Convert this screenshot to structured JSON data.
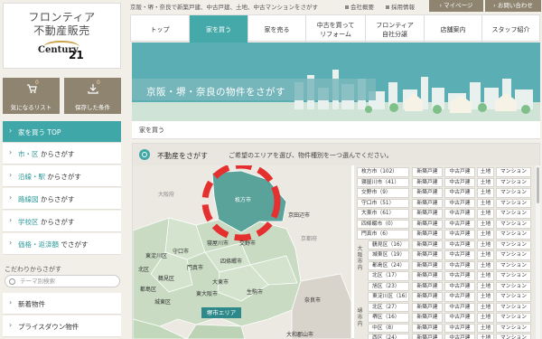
{
  "brand": {
    "line1": "フロンティア",
    "line2": "不動産販売",
    "logo_word": "Century",
    "logo_num": "21"
  },
  "top_util": {
    "tagline": "京阪・堺・奈良で新築戸建、中古戸建、土地、中古マンションをさがす",
    "links": [
      "会社概要",
      "採用情報"
    ],
    "buttons": [
      "マイページ",
      "お問い合わせ"
    ]
  },
  "sidebar": {
    "fav_label": "気になるリスト",
    "fav_count": "0",
    "saved_label": "保存した条件",
    "saved_count": "0",
    "items": [
      {
        "strong": "家を買う TOP",
        "rest": ""
      },
      {
        "strong": "市・区",
        "rest": " からさがす"
      },
      {
        "strong": "沿線・駅",
        "rest": " からさがす"
      },
      {
        "strong": "路線図",
        "rest": " からさがす"
      },
      {
        "strong": "学校区",
        "rest": " からさがす"
      },
      {
        "strong": "価格・返済額",
        "rest": " でさがす"
      }
    ],
    "kodawari_heading": "こだわりからさがす",
    "tag_placeholder": "テーマ別検索",
    "sub_items": [
      "新着物件",
      "プライスダウン物件"
    ]
  },
  "nav": {
    "tabs": [
      {
        "l1": "トップ",
        "l2": ""
      },
      {
        "l1": "家を買う",
        "l2": ""
      },
      {
        "l1": "家を売る",
        "l2": ""
      },
      {
        "l1": "中古を買って",
        "l2": "リフォーム"
      },
      {
        "l1": "フロンティア",
        "l2": "自社分譲"
      },
      {
        "l1": "店舗案内",
        "l2": ""
      },
      {
        "l1": "スタッフ紹介",
        "l2": ""
      }
    ],
    "active_index": 1
  },
  "hero": {
    "title": "京阪・堺・奈良の物件をさがす"
  },
  "breadcrumb": "家を買う",
  "search": {
    "title": "不動産をさがす",
    "instruction": "ご希望のエリアを選び、物件種別を一つ選んでください。",
    "sakai_area": "堺市エリア",
    "map_labels": {
      "kyoto": "京都府",
      "osaka_fu": "大阪府",
      "hirakata": "枚方市",
      "kyotanabe": "京田辺市",
      "katano": "交野市",
      "neyagawa": "寝屋川市",
      "shijonawate": "四條畷市",
      "moriguchi": "守口市",
      "kadoma": "門真市",
      "daito": "大東市",
      "higashi_yodogawa": "東淀川区",
      "higashiosaka": "東大阪市",
      "tsurumi": "鶴見区",
      "miyakojima": "都島区",
      "joto": "城東区",
      "ikoma": "生駒市",
      "nara": "奈良市",
      "yamatokoriyama": "大和郡山市",
      "kita": "北区"
    },
    "columns": [
      "新築戸建",
      "中古戸建",
      "土地",
      "マンション"
    ],
    "rows": [
      {
        "group": "",
        "name": "枚方市",
        "count": "102"
      },
      {
        "group": "",
        "name": "寝屋川市",
        "count": "41"
      },
      {
        "group": "",
        "name": "交野市",
        "count": "9"
      },
      {
        "group": "",
        "name": "守口市",
        "count": "51"
      },
      {
        "group": "",
        "name": "大東市",
        "count": "61"
      },
      {
        "group": "",
        "name": "四條畷市",
        "count": "0"
      },
      {
        "group": "",
        "name": "門真市",
        "count": "6"
      },
      {
        "group": "osaka",
        "name": "鶴見区",
        "count": "16"
      },
      {
        "group": "osaka",
        "name": "城東区",
        "count": "19"
      },
      {
        "group": "osaka",
        "name": "都島区",
        "count": "24"
      },
      {
        "group": "osaka",
        "name": "北区",
        "count": "17"
      },
      {
        "group": "osaka",
        "name": "旭区",
        "count": "23"
      },
      {
        "group": "osaka",
        "name": "東淀川区",
        "count": "16"
      },
      {
        "group": "sakai",
        "name": "北区",
        "count": "27"
      },
      {
        "group": "sakai",
        "name": "堺区",
        "count": "16"
      },
      {
        "group": "sakai",
        "name": "中区",
        "count": "8"
      },
      {
        "group": "sakai",
        "name": "西区",
        "count": "24"
      }
    ],
    "group_labels": {
      "osaka": "大阪市内",
      "sakai": "堺市内"
    }
  },
  "colors": {
    "accent": "#3fa7a7",
    "brown": "#8e8470",
    "map_green": "#c9dcc3",
    "map_dark": "#5aa39a",
    "highlight": "#e53030"
  }
}
